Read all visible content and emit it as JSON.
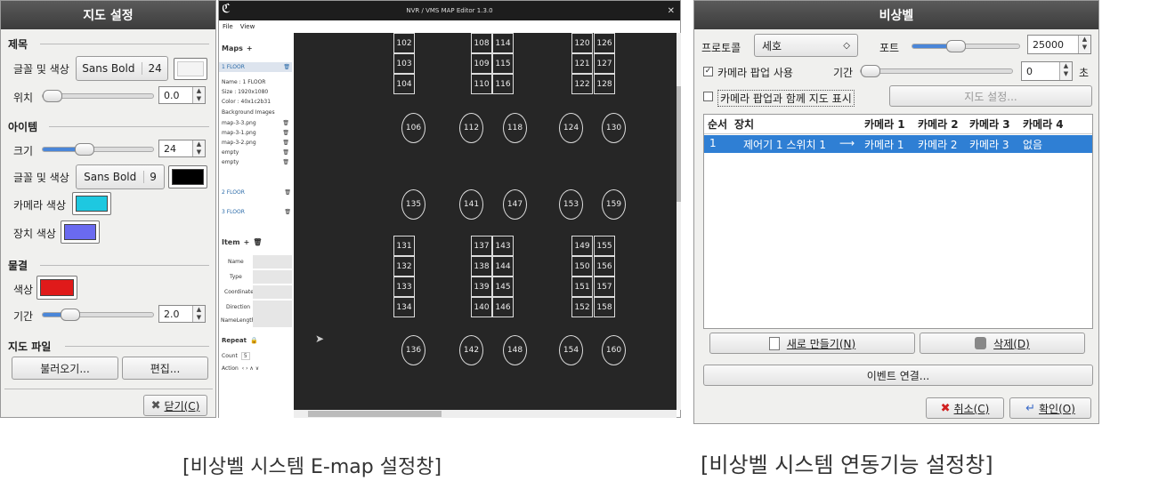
{
  "map_settings": {
    "title": "지도 설정",
    "title_section": "제목",
    "font_color_label": "글꼴 및 색상",
    "title_font": "Sans Bold",
    "title_font_size": "24",
    "position_label": "위치",
    "position_value": "0.0",
    "item_section": "아이템",
    "size_label": "크기",
    "size_value": "24",
    "item_font_color_label": "글꼴 및 색상",
    "item_font": "Sans Bold",
    "item_font_size": "9",
    "camera_color_label": "카메라 색상",
    "device_color_label": "장치 색상",
    "wave_section": "물결",
    "color_label": "색상",
    "duration_label": "기간",
    "duration_value": "2.0",
    "map_file_section": "지도 파일",
    "load_button": "불러오기...",
    "edit_button": "편집...",
    "close_button": "닫기(C)",
    "colors": {
      "title": "#f4f4f4",
      "item": "#000000",
      "camera": "#1ec8e0",
      "device": "#6a6af0",
      "wave": "#e01a1a"
    }
  },
  "editor": {
    "title": "NVR / VMS MAP Editor 1.3.0",
    "menu": [
      "File",
      "View"
    ],
    "maps_label": "Maps",
    "floor1": "1 FLOOR",
    "props": [
      "Name : 1 FLOOR",
      "Size : 1920x1080",
      "Color : 40x1c2b31"
    ],
    "bg_label": "Background Images",
    "bg_images": [
      "map-3-3.png",
      "map-3-1.png",
      "map-3-2.png",
      "empty",
      "empty"
    ],
    "floor2": "2 FLOOR",
    "floor3": "3 FLOOR",
    "item_label": "Item",
    "item_fields": [
      "Name",
      "Type",
      "Coordinate",
      "Direction",
      "NameLength"
    ],
    "repeat_label": "Repeat",
    "count_label": "Count",
    "count_value": "5",
    "action_label": "Action",
    "action_symbols": "‹  ›  ∧  ∨",
    "grid_rows": [
      [
        "102",
        "108",
        "114",
        "120",
        "126"
      ],
      [
        "103",
        "109",
        "115",
        "121",
        "127"
      ],
      [
        "104",
        "110",
        "116",
        "122",
        "128"
      ],
      [
        "131",
        "137",
        "143",
        "149",
        "155"
      ],
      [
        "132",
        "138",
        "144",
        "150",
        "156"
      ],
      [
        "133",
        "139",
        "145",
        "151",
        "157"
      ],
      [
        "134",
        "140",
        "146",
        "152",
        "158"
      ]
    ],
    "circles_row1": [
      "106",
      "112",
      "118",
      "124",
      "130"
    ],
    "circles_row2": [
      "135",
      "141",
      "147",
      "153",
      "159"
    ],
    "circles_row3": [
      "136",
      "142",
      "148",
      "154",
      "160"
    ]
  },
  "emergency": {
    "title": "비상벨",
    "protocol_label": "프로토콜",
    "protocol_value": "세호",
    "port_label": "포트",
    "port_value": "25000",
    "camera_popup_label": "카메라 팝업 사용",
    "period_label": "기간",
    "period_value": "0",
    "seconds_label": "초",
    "popup_with_map_label": "카메라 팝업과 함께 지도 표시",
    "map_settings_button": "지도 설정...",
    "columns": [
      "순서",
      "장치",
      "카메라 1",
      "카메라 2",
      "카메라 3",
      "카메라 4"
    ],
    "row": {
      "order": "1",
      "device": "제어기 1 스위치 1",
      "arrow": "⟶",
      "cam1": "카메라 1",
      "cam2": "카메라 2",
      "cam3": "카메라 3",
      "cam4": "없음"
    },
    "new_button": "새로 만들기(N)",
    "delete_button": "삭제(D)",
    "event_link_button": "이벤트 연결...",
    "cancel_button": "취소(C)",
    "ok_button": "확인(O)"
  },
  "captions": {
    "left": "[비상벨 시스템 E-map 설정창]",
    "right": "[비상벨 시스템 연동기능 설정창]"
  }
}
